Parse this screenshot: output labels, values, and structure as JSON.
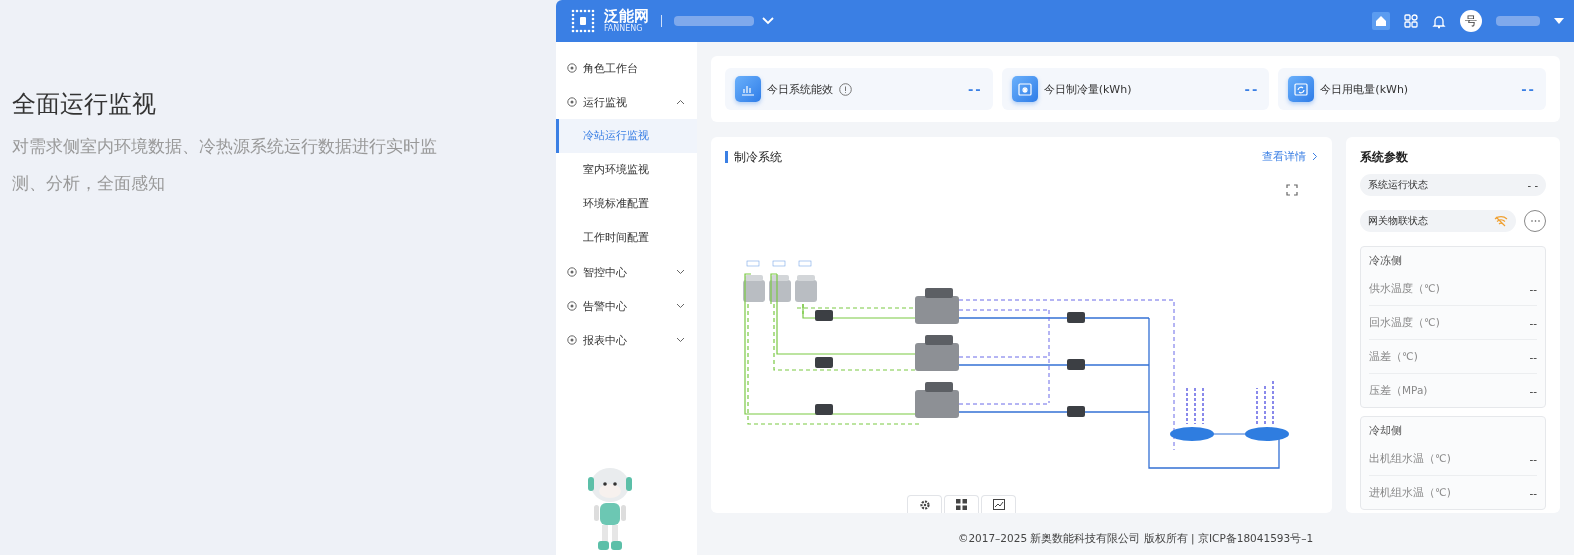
{
  "intro": {
    "title": "全面运行监视",
    "description": "对需求侧室内环境数据、冷热源系统运行数据进行实时监测、分析，全面感知"
  },
  "header": {
    "logo_text": "泛能网",
    "logo_subtext": "FANNENG",
    "avatar": "号"
  },
  "sidebar": {
    "items": [
      {
        "kind": "link",
        "label": "角色工作台"
      },
      {
        "kind": "group",
        "label": "运行监视",
        "expanded": true,
        "children": [
          {
            "label": "冷站运行监视",
            "selected": true
          },
          {
            "label": "室内环境监视",
            "selected": false
          },
          {
            "label": "环境标准配置",
            "selected": false
          },
          {
            "label": "工作时间配置",
            "selected": false
          }
        ]
      },
      {
        "kind": "group",
        "label": "智控中心",
        "expanded": false
      },
      {
        "kind": "group",
        "label": "告警中心",
        "expanded": false
      },
      {
        "kind": "group",
        "label": "报表中心",
        "expanded": false
      }
    ]
  },
  "kpis": [
    {
      "kind": "efficiency",
      "label": "今日系统能效",
      "info": true,
      "value": "--"
    },
    {
      "kind": "cooling",
      "label": "今日制冷量(kWh)",
      "info": false,
      "value": "--"
    },
    {
      "kind": "power",
      "label": "今日用电量(kWh)",
      "info": false,
      "value": "--"
    }
  ],
  "panel": {
    "title": "制冷系统",
    "link": "查看详情"
  },
  "params": {
    "title": "系统参数",
    "status_rows": [
      {
        "kind": "text",
        "label": "系统运行状态",
        "value": "- -"
      },
      {
        "kind": "wifi",
        "label": "网关物联状态"
      }
    ],
    "groups": [
      {
        "title": "冷冻侧",
        "rows": [
          {
            "label": "供水温度（℃)",
            "value": "--"
          },
          {
            "label": "回水温度（℃)",
            "value": "--"
          },
          {
            "label": "温差（℃)",
            "value": "--"
          },
          {
            "label": "压差（MPa)",
            "value": "--"
          }
        ]
      },
      {
        "title": "冷却侧",
        "rows": [
          {
            "label": "出机组水温（℃)",
            "value": "--"
          },
          {
            "label": "进机组水温（℃)",
            "value": "--"
          }
        ]
      }
    ]
  },
  "footer": "©2017–2025 新奥数能科技有限公司 版权所有 | 京ICP备18041593号–1"
}
